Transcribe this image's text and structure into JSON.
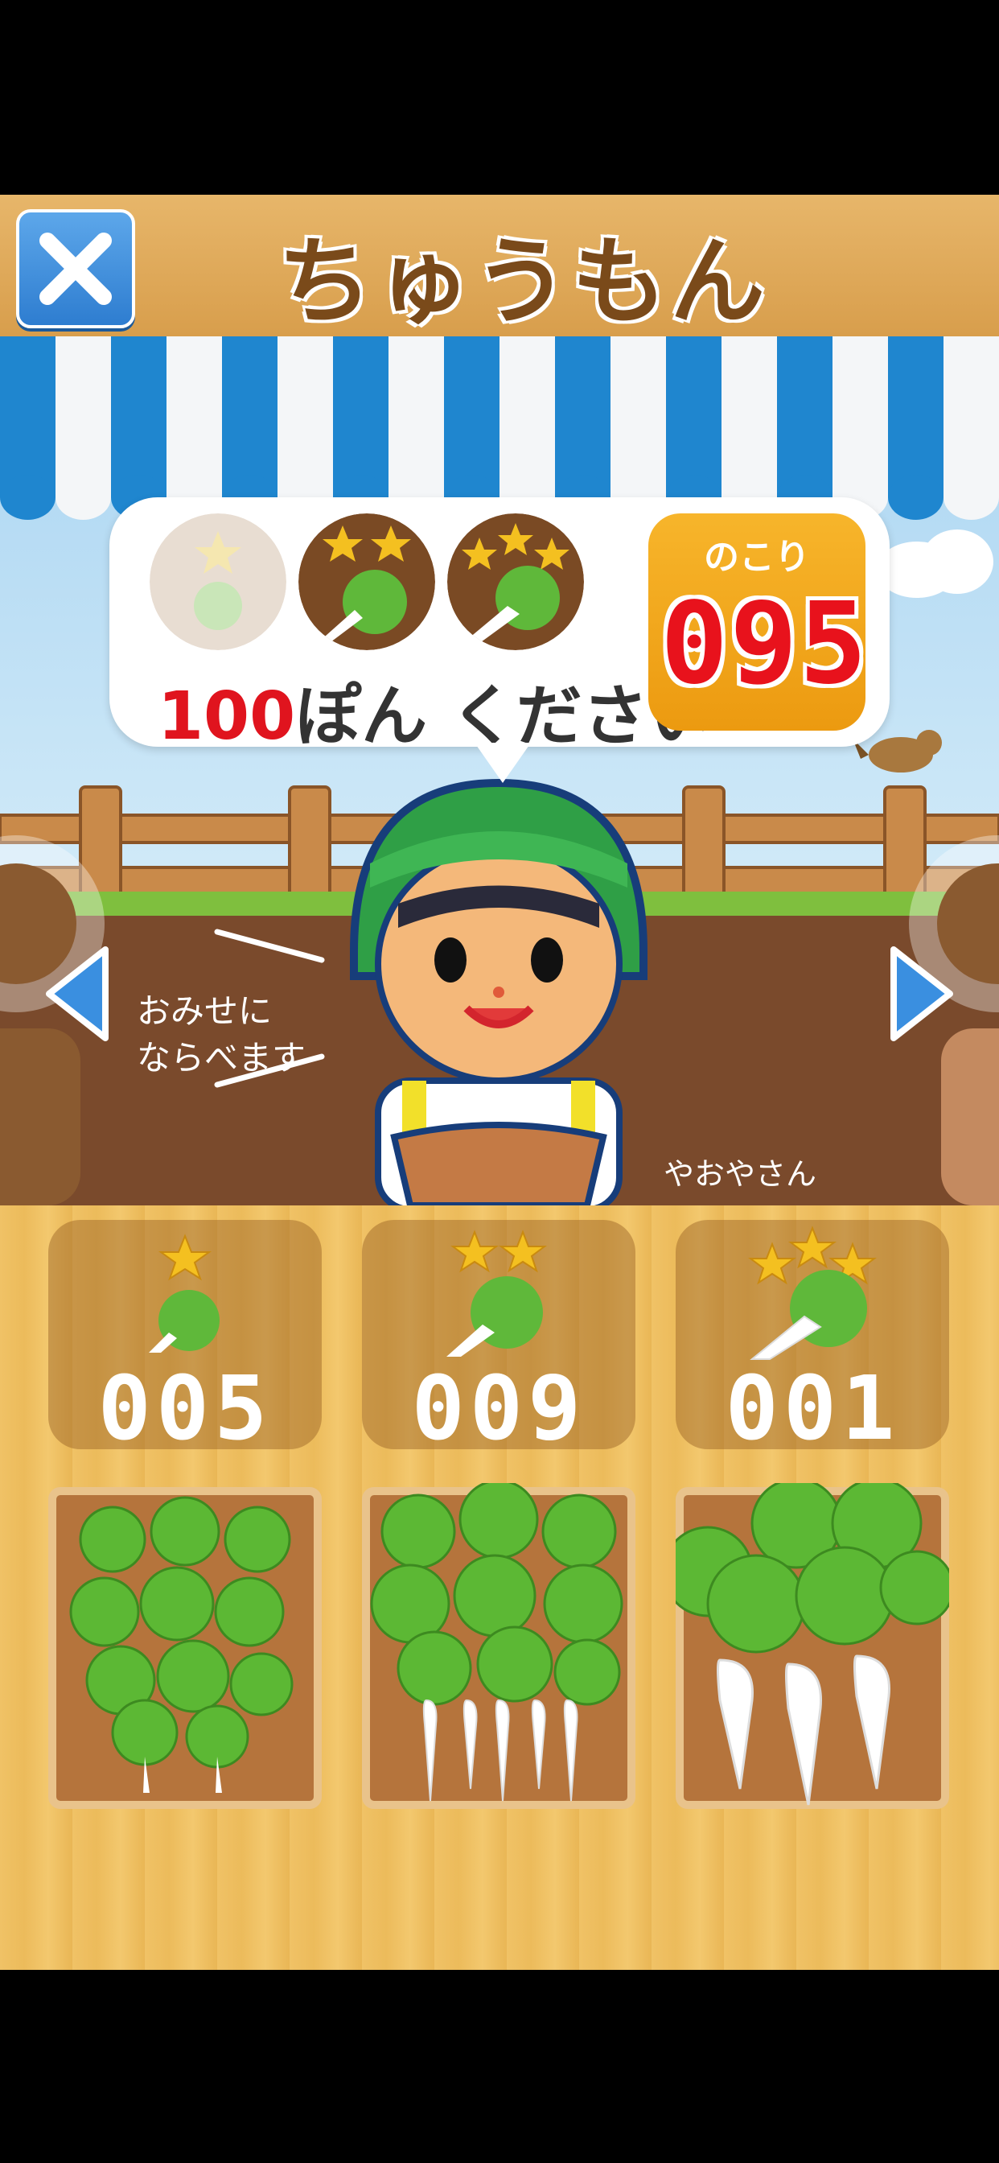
{
  "header": {
    "title": "ちゅうもん",
    "close_icon": "close-icon"
  },
  "order": {
    "quantity": "100",
    "request_text": "ぽん ください",
    "remaining_label": "のこり",
    "remaining_value": "095",
    "grades": [
      {
        "stars": 1,
        "state": "dimmed"
      },
      {
        "stars": 2,
        "state": "active"
      },
      {
        "stars": 3,
        "state": "active"
      }
    ]
  },
  "scene": {
    "shelf_hint_line1": "おみせに",
    "shelf_hint_line2": "ならべます",
    "shopkeeper_name": "やおやさん",
    "nav_prev_icon": "arrow-left-icon",
    "nav_next_icon": "arrow-right-icon"
  },
  "inventory": [
    {
      "stars": 1,
      "count": "005",
      "icon": "radish-sprout-icon"
    },
    {
      "stars": 2,
      "count": "009",
      "icon": "radish-small-icon"
    },
    {
      "stars": 3,
      "count": "001",
      "icon": "radish-large-icon"
    }
  ],
  "colors": {
    "accent_red": "#e0141e",
    "remaining_bg": "#f2a81c",
    "header_wood": "#dca553",
    "awning_blue": "#1f86cf"
  }
}
